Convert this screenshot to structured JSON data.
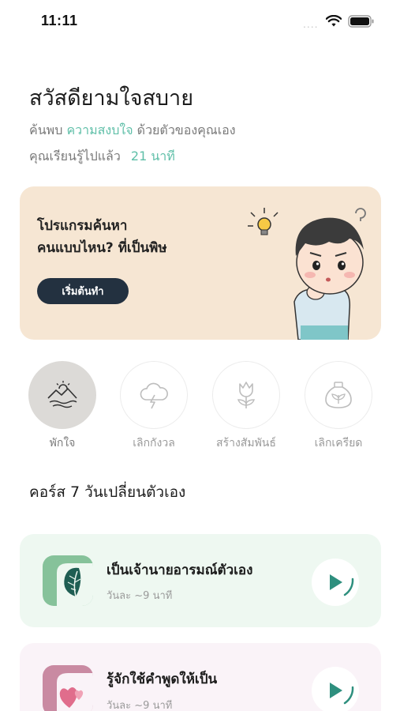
{
  "status_bar": {
    "time": "11:11",
    "signal": "....",
    "icons": [
      "wifi-icon",
      "battery-icon"
    ]
  },
  "header": {
    "greeting": "สวัสดียามใจสบาย",
    "subline_prefix": "ค้นพบ",
    "subline_highlight": "ความสงบใจ",
    "subline_suffix": "ด้วยตัวของคุณเอง",
    "progress_prefix": "คุณเรียนรู้ไปแล้ว",
    "progress_value": "21 นาที"
  },
  "banner": {
    "title_line1": "โปรแกรมค้นหา",
    "title_line2": "คนแบบไหน? ที่เป็นพิษ",
    "button_label": "เริ่มต้นทำ",
    "illustration": "thinking-boy-illustration"
  },
  "categories": [
    {
      "label": "พักใจ",
      "icon": "mountain-sun-icon",
      "active": true
    },
    {
      "label": "เลิกกังวล",
      "icon": "storm-cloud-icon",
      "active": false
    },
    {
      "label": "สร้างสัมพันธ์",
      "icon": "tulip-icon",
      "active": false
    },
    {
      "label": "เลิกเครียด",
      "icon": "herb-jar-icon",
      "active": false
    }
  ],
  "section": {
    "title": "คอร์ส 7 วันเปลี่ยนตัวเอง"
  },
  "courses": [
    {
      "title": "เป็นเจ้านายอารมณ์ตัวเอง",
      "meta": "วันละ ~9 นาที",
      "thumb": "leaf-icon",
      "accent": "#2e8f7e"
    },
    {
      "title": "รู้จักใช้คำพูดให้เป็น",
      "meta": "วันละ ~9 นาที",
      "thumb": "hearts-icon",
      "accent": "#2e8f7e"
    }
  ],
  "colors": {
    "accent": "#5fbfa8",
    "banner_bg": "#f6e6d3",
    "button_dark": "#233140",
    "play_green": "#2e8f7e"
  }
}
